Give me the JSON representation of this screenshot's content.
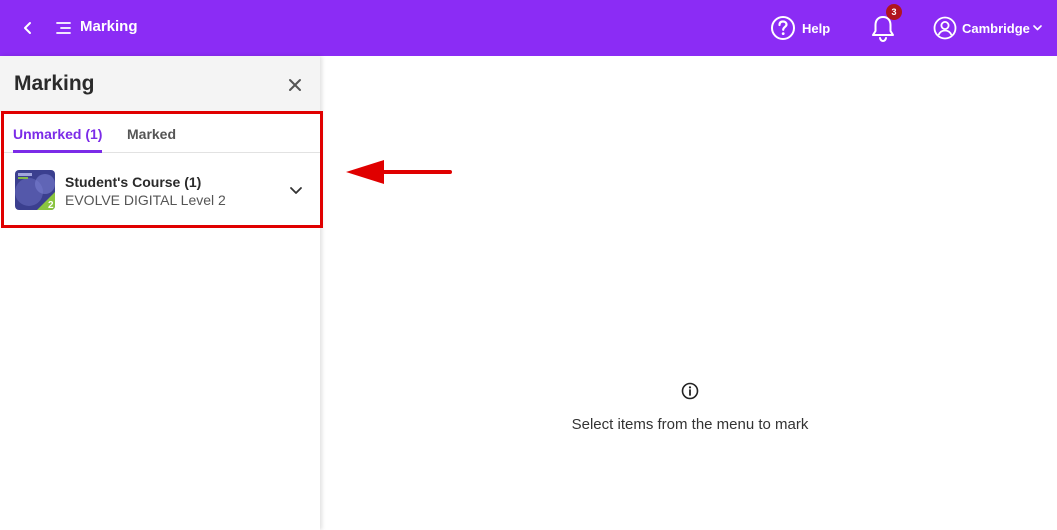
{
  "header": {
    "title": "Marking",
    "help_label": "Help",
    "notification_count": "3",
    "account_label": "Cambridge",
    "background_color": "#8b2cf5"
  },
  "sidebar": {
    "title": "Marking",
    "tabs": [
      {
        "label": "Unmarked (1)",
        "active": true
      },
      {
        "label": "Marked",
        "active": false
      }
    ],
    "courses": [
      {
        "title": "Student's Course (1)",
        "subtitle": "EVOLVE DIGITAL Level 2"
      }
    ]
  },
  "main": {
    "empty_message": "Select items from the menu to mark"
  },
  "colors": {
    "accent": "#7b2be8",
    "annotation": "#e00000"
  }
}
